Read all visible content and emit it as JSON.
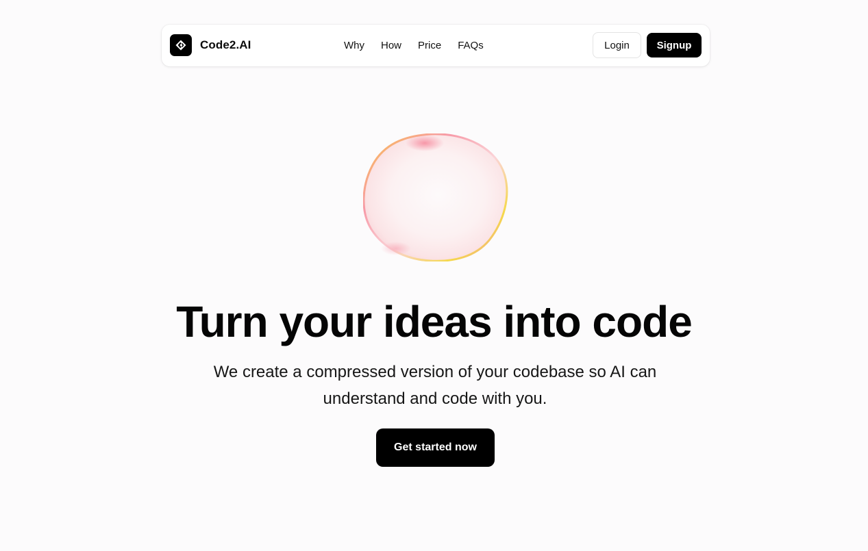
{
  "brand": {
    "name": "Code2.AI",
    "logo_icon": "code-diamond-icon"
  },
  "nav": {
    "links": [
      "Why",
      "How",
      "Price",
      "FAQs"
    ]
  },
  "auth": {
    "login_label": "Login",
    "signup_label": "Signup"
  },
  "hero": {
    "orb_icon": "gradient-orb",
    "headline": "Turn your ideas into code",
    "subtext": "We create a compressed version of your codebase so AI can understand and code with you.",
    "cta_label": "Get started now"
  },
  "colors": {
    "background": "#fcfbfc",
    "primary": "#000000",
    "orb_accent_pink": "#f6a4b4",
    "orb_accent_yellow": "#f7d64a"
  }
}
